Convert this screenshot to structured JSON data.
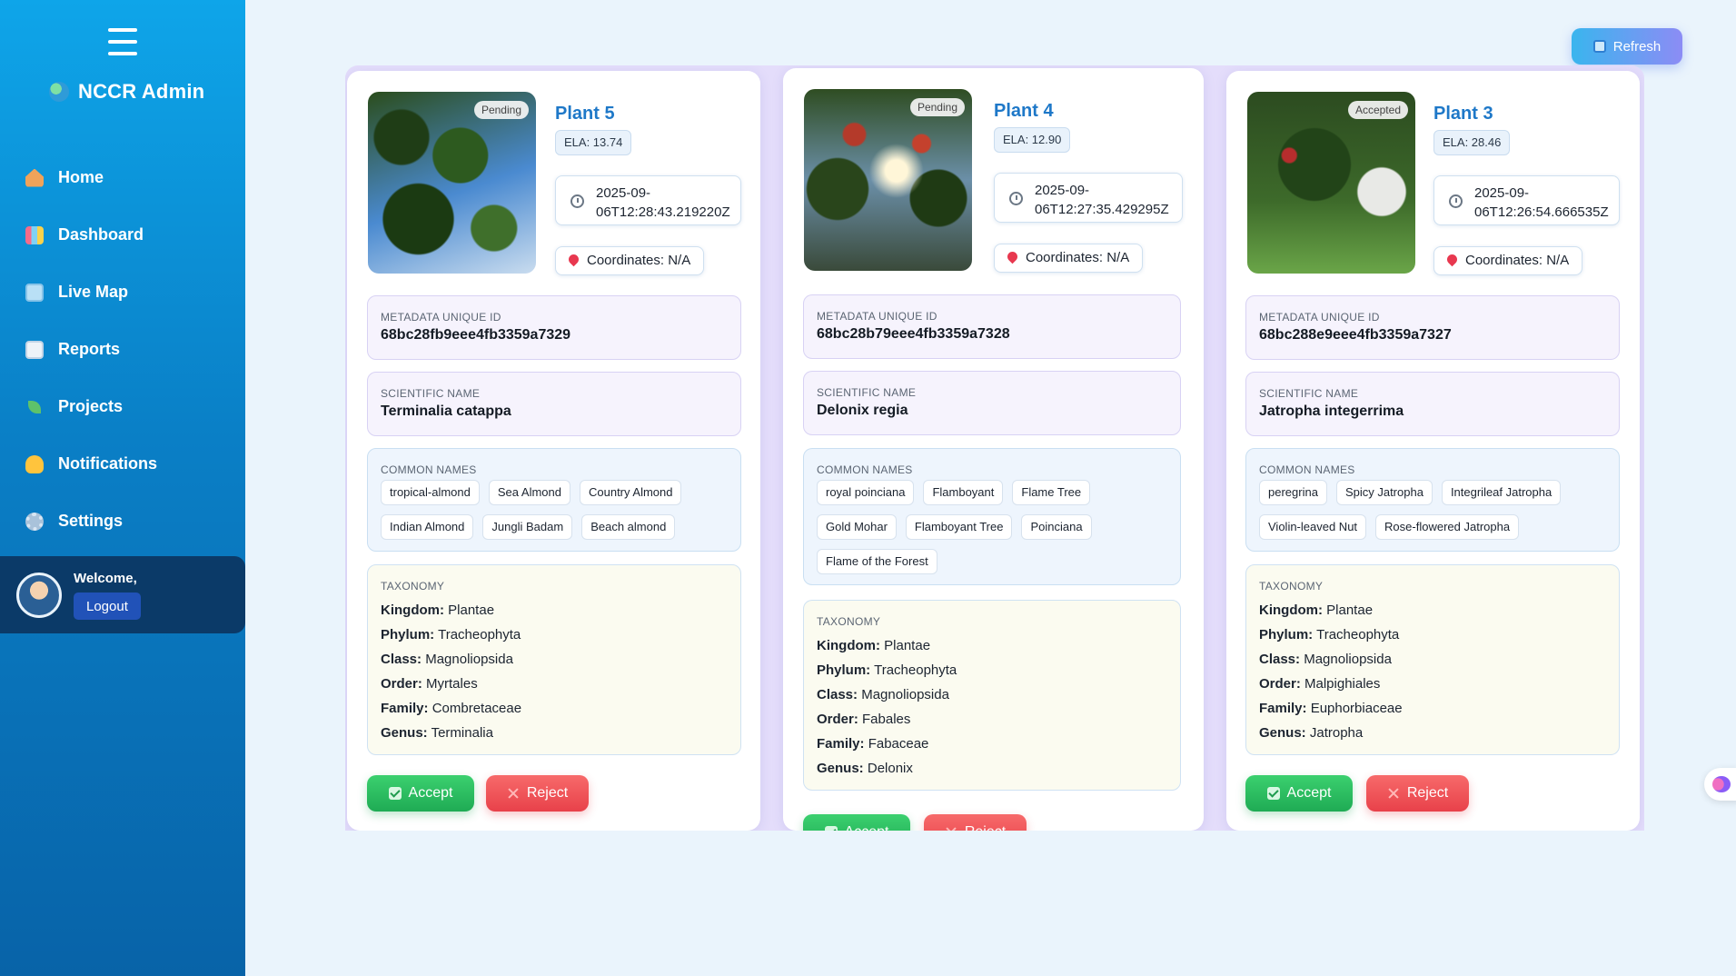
{
  "sidebar": {
    "brand": "NCCR Admin",
    "items": [
      {
        "label": "Home",
        "icon": "home-icon"
      },
      {
        "label": "Dashboard",
        "icon": "chart-icon"
      },
      {
        "label": "Live Map",
        "icon": "map-icon"
      },
      {
        "label": "Reports",
        "icon": "document-icon"
      },
      {
        "label": "Projects",
        "icon": "seedling-icon"
      },
      {
        "label": "Notifications",
        "icon": "bell-icon"
      },
      {
        "label": "Settings",
        "icon": "gear-icon"
      }
    ],
    "welcome": "Welcome,",
    "logout": "Logout"
  },
  "toolbar": {
    "refresh": "Refresh"
  },
  "labels": {
    "metadata_id": "METADATA UNIQUE ID",
    "scientific_name": "SCIENTIFIC NAME",
    "common_names": "COMMON NAMES",
    "taxonomy": "TAXONOMY",
    "kingdom": "Kingdom:",
    "phylum": "Phylum:",
    "class": "Class:",
    "order": "Order:",
    "family": "Family:",
    "genus": "Genus:",
    "accept": "Accept",
    "reject": "Reject"
  },
  "cards": [
    {
      "title": "Plant 5",
      "status": "Pending",
      "ela": "ELA: 13.74",
      "date": "2025-09-06T12:28:43.219220Z",
      "coordinates": "Coordinates: N/A",
      "metadata_id": "68bc28fb9eee4fb3359a7329",
      "scientific_name": "Terminalia catappa",
      "common_names": [
        "tropical-almond",
        "Sea Almond",
        "Country Almond",
        "Indian Almond",
        "Jungli Badam",
        "Beach almond"
      ],
      "taxonomy": {
        "kingdom": "Plantae",
        "phylum": "Tracheophyta",
        "class": "Magnoliopsida",
        "order": "Myrtales",
        "family": "Combretaceae",
        "genus": "Terminalia"
      }
    },
    {
      "title": "Plant 4",
      "status": "Pending",
      "ela": "ELA: 12.90",
      "date": "2025-09-06T12:27:35.429295Z",
      "coordinates": "Coordinates: N/A",
      "metadata_id": "68bc28b79eee4fb3359a7328",
      "scientific_name": "Delonix regia",
      "common_names": [
        "royal poinciana",
        "Flamboyant",
        "Flame Tree",
        "Gold Mohar",
        "Flamboyant Tree",
        "Poinciana",
        "Flame of the Forest"
      ],
      "taxonomy": {
        "kingdom": "Plantae",
        "phylum": "Tracheophyta",
        "class": "Magnoliopsida",
        "order": "Fabales",
        "family": "Fabaceae",
        "genus": "Delonix"
      }
    },
    {
      "title": "Plant 3",
      "status": "Accepted",
      "ela": "ELA: 28.46",
      "date": "2025-09-06T12:26:54.666535Z",
      "coordinates": "Coordinates: N/A",
      "metadata_id": "68bc288e9eee4fb3359a7327",
      "scientific_name": "Jatropha integerrima",
      "common_names": [
        "peregrina",
        "Spicy Jatropha",
        "Integrileaf Jatropha",
        "Violin-leaved Nut",
        "Rose-flowered Jatropha"
      ],
      "taxonomy": {
        "kingdom": "Plantae",
        "phylum": "Tracheophyta",
        "class": "Magnoliopsida",
        "order": "Malpighiales",
        "family": "Euphorbiaceae",
        "genus": "Jatropha"
      }
    }
  ]
}
